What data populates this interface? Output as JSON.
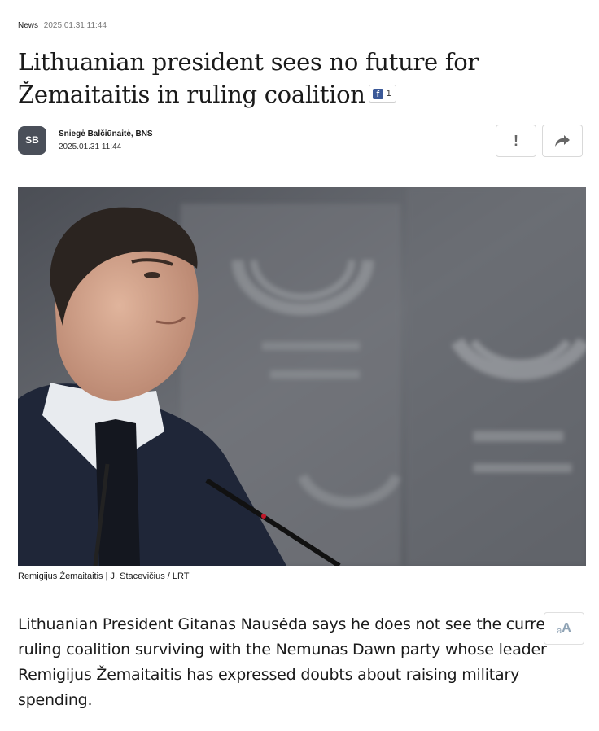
{
  "article": {
    "category": "News",
    "published": "2025.01.31 11:44",
    "title": "Lithuanian president sees no future for Žemaitaitis in ruling coalition",
    "facebook_count": "1",
    "author": {
      "initials": "SB",
      "name": "Sniegė Balčiūnaitė, BNS",
      "date": "2025.01.31 11:44"
    },
    "actions": {
      "report_icon": "!",
      "share_icon": "share-arrow-icon"
    },
    "photo_caption": "Remigijus Žemaitaitis | J. Stacevičius / LRT",
    "lead": "Lithuanian President Gitanas Nausėda says he does not see the current ruling coalition surviving with the Nemunas Dawn party whose leader Remigijus Žemaitaitis has expressed doubts about raising military spending.",
    "text_size_button": {
      "small": "a",
      "big": "A"
    }
  },
  "colors": {
    "facebook": "#3b5998",
    "avatar_bg": "#4a4f59",
    "text_size_icon": "#8fa3b5"
  }
}
